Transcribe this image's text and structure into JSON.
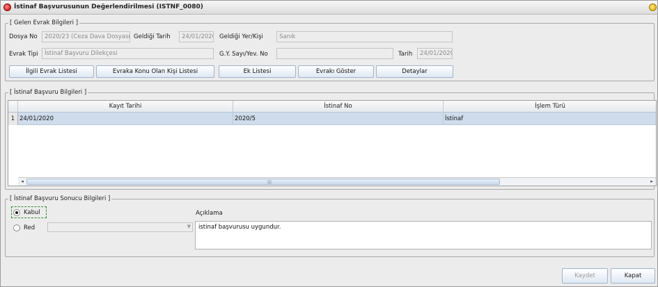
{
  "window": {
    "title": "İstinaf Başvurusunun Değerlendirilmesi (ISTNF_0080)"
  },
  "gelen_evrak": {
    "legend": "[ Gelen Evrak Bilgileri ]",
    "dosya_no_label": "Dosya No",
    "dosya_no_value": "2020/23 (Ceza Dava Dosyası)",
    "geldigi_tarih_label": "Geldiği Tarih",
    "geldigi_tarih_value": "24/01/2020 1",
    "geldigi_yer_label": "Geldiği Yer/Kişi",
    "geldigi_yer_value": "Sanık",
    "evrak_tipi_label": "Evrak Tipi",
    "evrak_tipi_value": "İstinaf Başvuru Dilekçesi",
    "gy_sayi_label": "G.Y. Sayı/Yev. No",
    "gy_sayi_value": "",
    "tarih_label": "Tarih",
    "tarih_value": "24/01/2020",
    "buttons": {
      "ilgili_evrak": "İlgili Evrak Listesi",
      "evraka_konu": "Evraka Konu Olan Kişi Listesi",
      "ek_listesi": "Ek Listesi",
      "evraki_goster": "Evrakı Göster",
      "detaylar": "Detaylar"
    }
  },
  "istinaf_basvuru": {
    "legend": "[ İstinaf Başvuru Bilgileri ]",
    "columns": [
      "Kayıt Tarihi",
      "İstinaf No",
      "İşlem Türü"
    ],
    "rows": [
      {
        "num": "1",
        "kayit_tarihi": "24/01/2020",
        "istinaf_no": "2020/5",
        "islem_turu": "İstinaf"
      }
    ]
  },
  "sonuc": {
    "legend": "[ İstinaf Başvuru Sonucu Bilgileri ]",
    "kabul_label": "Kabul",
    "red_label": "Red",
    "selected": "Kabul",
    "red_select_value": "",
    "aciklama_label": "Açıklama",
    "aciklama_value": "istinaf başvurusu uygundur."
  },
  "footer": {
    "kaydet_label": "Kaydet",
    "kapat_label": "Kapat"
  }
}
